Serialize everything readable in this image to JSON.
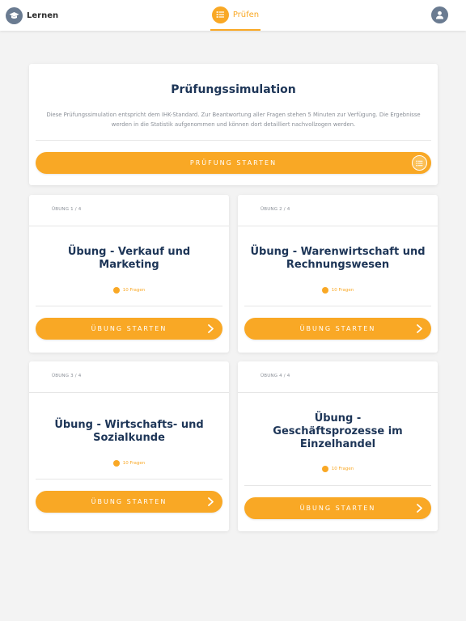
{
  "nav": {
    "learn_label": "Lernen",
    "pruefen_label": "Prüfen",
    "active_color": "#f9a825",
    "icons": {
      "learn": "graduation-cap-icon",
      "pruefen": "list-icon",
      "user": "user-icon"
    }
  },
  "simulation": {
    "title": "Prüfungssimulation",
    "description": "Diese Prüfungssimulation entspricht dem IHK-Standard. Zur Beantwortung aller Fragen stehen 5 Minuten zur Verfügung. Die Ergebnisse werden in die Statistik aufgenommen und können dort detailliert nachvollzogen werden.",
    "button_label": "PRÜFUNG STARTEN",
    "button_icon": "list-icon"
  },
  "exercises": [
    {
      "number": "ÜBUNG 1 / 4",
      "title": "Übung - Verkauf und Marketing",
      "questions": "10 Fragen",
      "button_label": "ÜBUNG STARTEN"
    },
    {
      "number": "ÜBUNG 2 / 4",
      "title": "Übung - Warenwirtschaft und Rechnungswesen",
      "questions": "10 Fragen",
      "button_label": "ÜBUNG STARTEN"
    },
    {
      "number": "ÜBUNG 3 / 4",
      "title": "Übung - Wirtschafts- und Sozialkunde",
      "questions": "10 Fragen",
      "button_label": "ÜBUNG STARTEN"
    },
    {
      "number": "ÜBUNG 4 / 4",
      "title": "Übung - Geschäftsprozesse im Einzelhandel",
      "questions": "10 Fragen",
      "button_label": "ÜBUNG STARTEN"
    }
  ],
  "colors": {
    "accent": "#f9a825",
    "heading": "#1d3557",
    "muted": "#8a8f97"
  }
}
